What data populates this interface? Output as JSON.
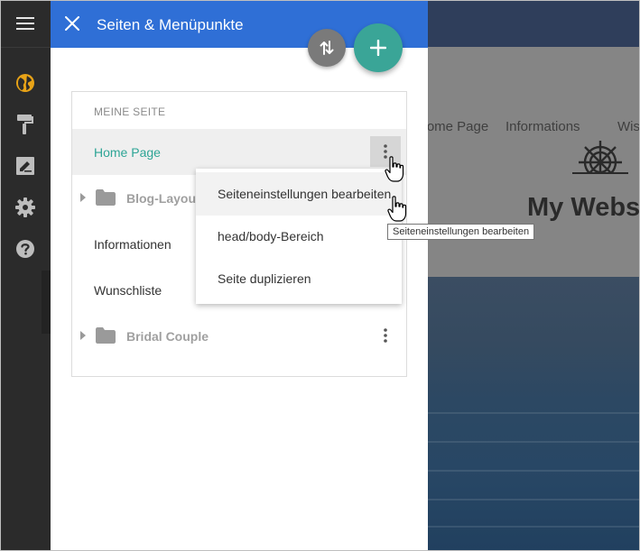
{
  "panel": {
    "title": "Seiten & Menüpunkte",
    "section_label": "MEINE SEITE",
    "pages": [
      {
        "label": "Home Page"
      },
      {
        "label": "Blog-Layout"
      },
      {
        "label": "Informationen"
      },
      {
        "label": "Wunschliste"
      },
      {
        "label": "Bridal Couple"
      }
    ]
  },
  "dropdown": {
    "items": [
      {
        "label": "Seiteneinstellungen bearbeiten"
      },
      {
        "label": "head/body-Bereich"
      },
      {
        "label": "Seite duplizieren"
      }
    ]
  },
  "tooltip": "Seiteneinstellungen bearbeiten",
  "preview": {
    "nav": [
      "Home Page",
      "Informations",
      "Wis"
    ],
    "site_title": "My Websi"
  },
  "icons": {
    "toolbar": [
      "menu-icon",
      "globe-icon",
      "paint-roller-icon",
      "edit-icon",
      "gear-icon",
      "help-icon"
    ],
    "panel": [
      "close-icon",
      "sort-icon",
      "plus-icon",
      "more-vert-icon",
      "folder-icon",
      "caret-right-icon"
    ]
  },
  "colors": {
    "header": "#2f6fd6",
    "accent": "#3aa597",
    "active_page": "#2ea596",
    "toolbar": "#2b2b2b",
    "globe": "#e8a317"
  }
}
